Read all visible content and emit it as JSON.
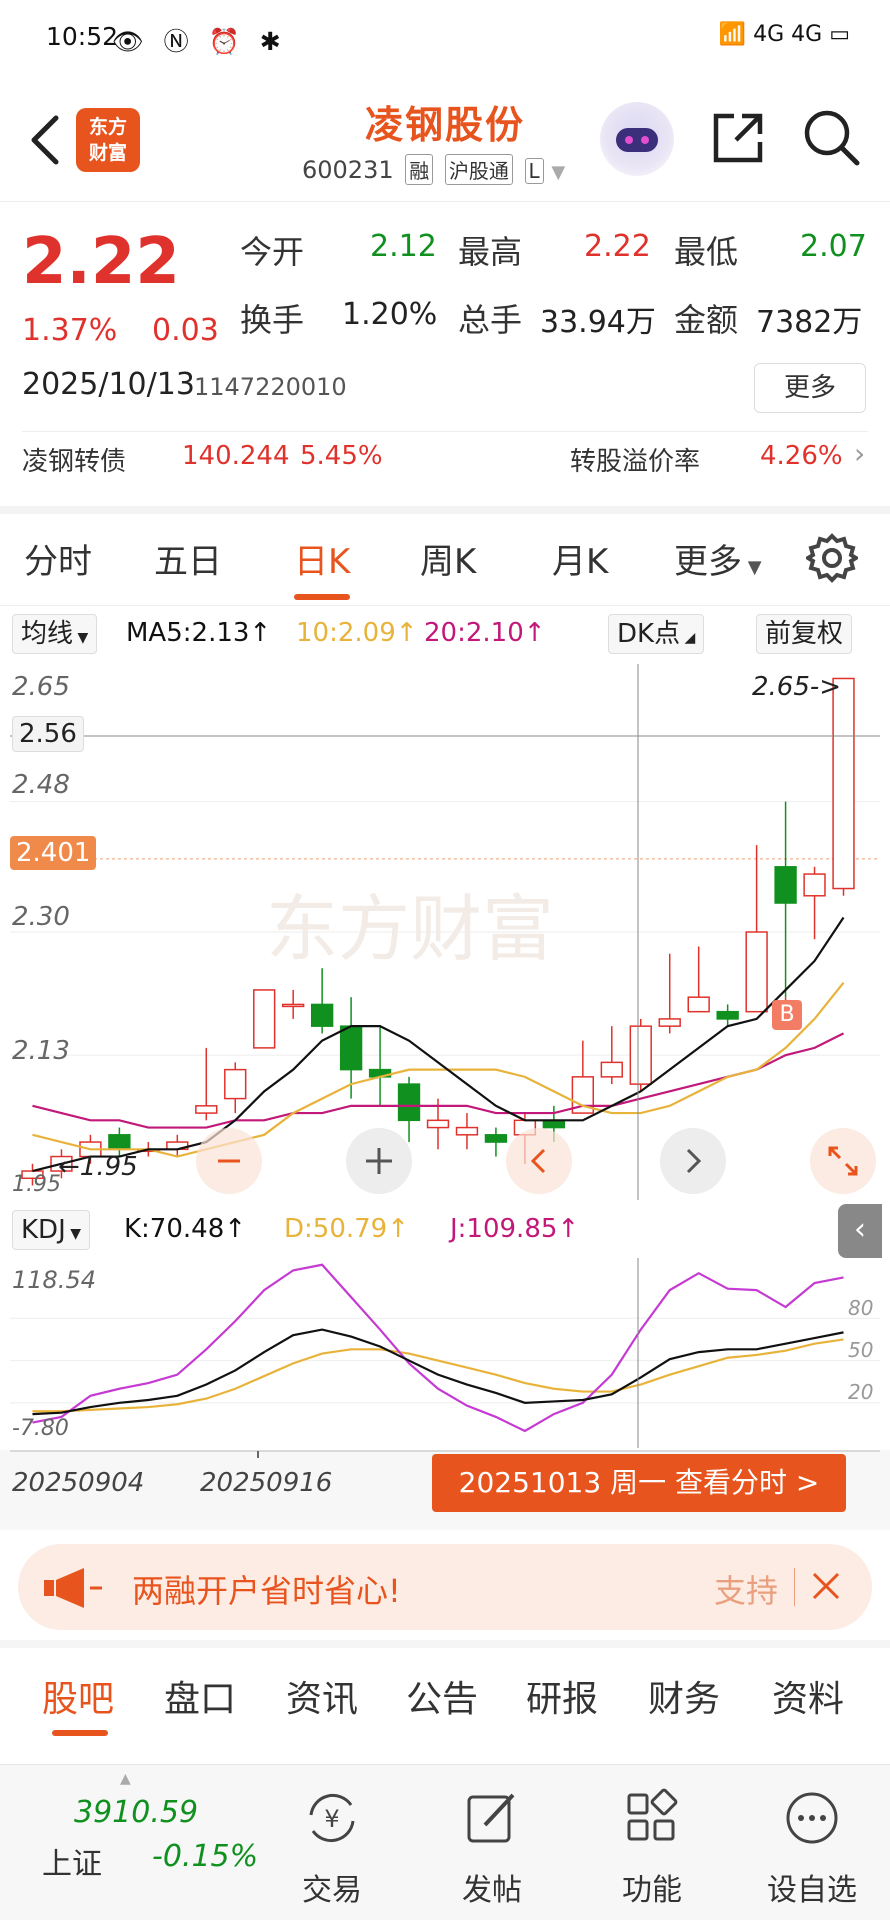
{
  "status_bar": {
    "time": "10:52",
    "left_icons": "👁 Ⓝ ⏰ ✱",
    "right_icons": "📶 4G 4G ▭"
  },
  "header": {
    "stock_name": "凌钢股份",
    "stock_code": "600231",
    "tags": [
      "融",
      "沪股通",
      "L"
    ],
    "logo_line1": "东方",
    "logo_line2": "财富"
  },
  "quote": {
    "price": "2.22",
    "change_pct": "1.37%",
    "change_abs": "0.03",
    "open_label": "今开",
    "open": "2.12",
    "high_label": "最高",
    "high": "2.22",
    "low_label": "最低",
    "low": "2.07",
    "turnover_label": "换手",
    "turnover": "1.20%",
    "volume_label": "总手",
    "volume": "33.94万",
    "amount_label": "金额",
    "amount": "7382万",
    "date": "2025/10/13",
    "code_num": "1147220010",
    "more_label": "更多"
  },
  "bond": {
    "name": "凌钢转债",
    "price": "140.244",
    "pct": "5.45%",
    "premium_label": "转股溢价率",
    "premium": "4.26%"
  },
  "period_tabs": [
    "分时",
    "五日",
    "日K",
    "周K",
    "月K",
    "更多"
  ],
  "active_period": "日K",
  "ma_row": {
    "ma_selector": "均线",
    "ma5": "MA5:2.13↑",
    "ma10": "10:2.09↑",
    "ma20": "20:2.10↑",
    "dk_label": "DK点",
    "adjust_label": "前复权"
  },
  "chart_axis": {
    "y_ticks": [
      "2.65",
      "2.56",
      "2.48",
      "2.401",
      "2.30",
      "2.13",
      "1.95"
    ],
    "max_marker": "2.65->",
    "min_marker": "←1.95",
    "crosshair_price": "2.56",
    "current_price_tag": "2.401",
    "buy_marker": "B",
    "watermark": "东方财富"
  },
  "chart_data": {
    "type": "candlestick",
    "candles": [
      {
        "o": 1.96,
        "c": 1.97,
        "h": 1.98,
        "l": 1.95
      },
      {
        "o": 1.97,
        "c": 1.99,
        "h": 2.0,
        "l": 1.96
      },
      {
        "o": 1.99,
        "c": 2.01,
        "h": 2.02,
        "l": 1.98
      },
      {
        "o": 2.02,
        "c": 2.0,
        "h": 2.03,
        "l": 1.99
      },
      {
        "o": 2.0,
        "c": 2.0,
        "h": 2.01,
        "l": 1.99
      },
      {
        "o": 2.0,
        "c": 2.01,
        "h": 2.02,
        "l": 1.99
      },
      {
        "o": 2.05,
        "c": 2.06,
        "h": 2.14,
        "l": 2.04
      },
      {
        "o": 2.07,
        "c": 2.11,
        "h": 2.12,
        "l": 2.05
      },
      {
        "o": 2.14,
        "c": 2.22,
        "h": 2.22,
        "l": 2.14
      },
      {
        "o": 2.2,
        "c": 2.2,
        "h": 2.22,
        "l": 2.18
      },
      {
        "o": 2.2,
        "c": 2.17,
        "h": 2.25,
        "l": 2.16
      },
      {
        "o": 2.17,
        "c": 2.11,
        "h": 2.21,
        "l": 2.07
      },
      {
        "o": 2.11,
        "c": 2.1,
        "h": 2.17,
        "l": 2.06
      },
      {
        "o": 2.09,
        "c": 2.04,
        "h": 2.1,
        "l": 2.01
      },
      {
        "o": 2.03,
        "c": 2.04,
        "h": 2.07,
        "l": 2.0
      },
      {
        "o": 2.02,
        "c": 2.03,
        "h": 2.05,
        "l": 2.0
      },
      {
        "o": 2.02,
        "c": 2.01,
        "h": 2.03,
        "l": 1.99
      },
      {
        "o": 2.02,
        "c": 2.04,
        "h": 2.05,
        "l": 1.98
      },
      {
        "o": 2.04,
        "c": 2.03,
        "h": 2.06,
        "l": 2.01
      },
      {
        "o": 2.05,
        "c": 2.1,
        "h": 2.15,
        "l": 2.05
      },
      {
        "o": 2.1,
        "c": 2.12,
        "h": 2.17,
        "l": 2.09
      },
      {
        "o": 2.09,
        "c": 2.17,
        "h": 2.18,
        "l": 2.08
      },
      {
        "o": 2.17,
        "c": 2.18,
        "h": 2.27,
        "l": 2.16
      },
      {
        "o": 2.19,
        "c": 2.21,
        "h": 2.28,
        "l": 2.19
      },
      {
        "o": 2.19,
        "c": 2.18,
        "h": 2.2,
        "l": 2.17
      },
      {
        "o": 2.19,
        "c": 2.3,
        "h": 2.42,
        "l": 2.19
      },
      {
        "o": 2.39,
        "c": 2.34,
        "h": 2.48,
        "l": 2.21
      },
      {
        "o": 2.35,
        "c": 2.38,
        "h": 2.39,
        "l": 2.29
      },
      {
        "o": 2.36,
        "c": 2.65,
        "h": 2.65,
        "l": 2.35
      }
    ],
    "ma5": [
      1.97,
      1.98,
      1.99,
      1.99,
      2.0,
      2.0,
      2.01,
      2.04,
      2.08,
      2.11,
      2.15,
      2.17,
      2.17,
      2.15,
      2.12,
      2.09,
      2.06,
      2.04,
      2.04,
      2.04,
      2.06,
      2.08,
      2.11,
      2.14,
      2.17,
      2.18,
      2.22,
      2.26,
      2.32
    ],
    "ma10": [
      2.02,
      2.01,
      2.0,
      2.0,
      2.0,
      1.99,
      2.0,
      2.01,
      2.02,
      2.05,
      2.07,
      2.09,
      2.1,
      2.11,
      2.11,
      2.11,
      2.11,
      2.1,
      2.08,
      2.06,
      2.05,
      2.05,
      2.06,
      2.08,
      2.1,
      2.11,
      2.14,
      2.18,
      2.23
    ],
    "ma20": [
      2.06,
      2.05,
      2.04,
      2.04,
      2.03,
      2.03,
      2.03,
      2.04,
      2.04,
      2.05,
      2.05,
      2.06,
      2.06,
      2.06,
      2.06,
      2.06,
      2.05,
      2.05,
      2.05,
      2.06,
      2.06,
      2.07,
      2.08,
      2.09,
      2.1,
      2.11,
      2.13,
      2.14,
      2.16
    ],
    "y_range": [
      1.93,
      2.67
    ],
    "buy_signal_index": 26,
    "x_dates": [
      "20250904",
      "20250916"
    ],
    "selected_date": "20251013"
  },
  "kdj": {
    "selector": "KDJ",
    "k": "K:70.48↑",
    "d": "D:50.79↑",
    "j": "J:109.85↑",
    "y_top": "118.54",
    "y_bottom": "-7.80",
    "levels": [
      "80",
      "50",
      "20"
    ],
    "chart_data": {
      "type": "line",
      "K": [
        12,
        13,
        17,
        20,
        22,
        25,
        33,
        43,
        56,
        68,
        72,
        67,
        60,
        50,
        40,
        33,
        27,
        20,
        21,
        22,
        26,
        38,
        51,
        56,
        58,
        58,
        62,
        66,
        70
      ],
      "D": [
        14,
        14,
        15,
        16,
        17,
        19,
        23,
        30,
        39,
        48,
        55,
        58,
        58,
        55,
        50,
        45,
        40,
        34,
        30,
        28,
        28,
        33,
        40,
        46,
        52,
        54,
        57,
        62,
        65
      ],
      "J": [
        6,
        10,
        25,
        30,
        34,
        40,
        58,
        78,
        100,
        114,
        118,
        95,
        72,
        48,
        30,
        18,
        10,
        0,
        12,
        20,
        40,
        72,
        100,
        112,
        101,
        100,
        88,
        105,
        109
      ],
      "y_range": [
        -7.8,
        118.54
      ]
    }
  },
  "date_row": {
    "date_left": "20250904",
    "date_mid": "20250916",
    "view_intraday": "20251013 周一 查看分时 >"
  },
  "banner": {
    "text": "两融开户省时省心!",
    "support": "支持"
  },
  "bottom_tabs": [
    "股吧",
    "盘口",
    "资讯",
    "公告",
    "研报",
    "财务",
    "资料"
  ],
  "active_bottom_tab": "股吧",
  "bottom_nav": {
    "index_value": "3910.59",
    "index_name": "上证",
    "index_change": "-0.15%",
    "items": [
      "交易",
      "发帖",
      "功能",
      "设自选"
    ]
  },
  "colors": {
    "accent": "#e8541e",
    "up": "#e0322c",
    "down": "#10911f",
    "ma5": "#111111",
    "ma10": "#e8b33a",
    "ma20": "#c2187a"
  }
}
